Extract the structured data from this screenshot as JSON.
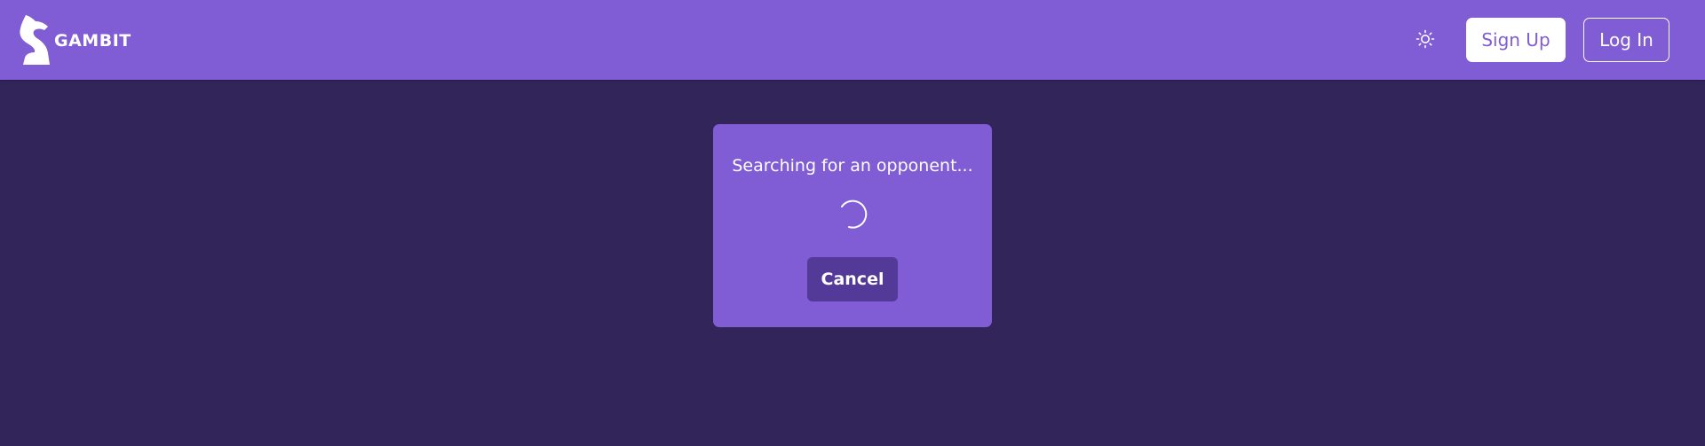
{
  "header": {
    "logo_text": "GAMBIT",
    "logo_icon": "chess-knight-icon",
    "theme_toggle_icon": "sun-icon",
    "signup_label": "Sign Up",
    "login_label": "Log In"
  },
  "search_dialog": {
    "message": "Searching for an opponent...",
    "spinner_icon": "loading-spinner-icon",
    "cancel_label": "Cancel"
  },
  "colors": {
    "page_background": "#312559",
    "accent": "#805cd5",
    "cancel_button": "#533a98",
    "text": "#ffffff"
  }
}
